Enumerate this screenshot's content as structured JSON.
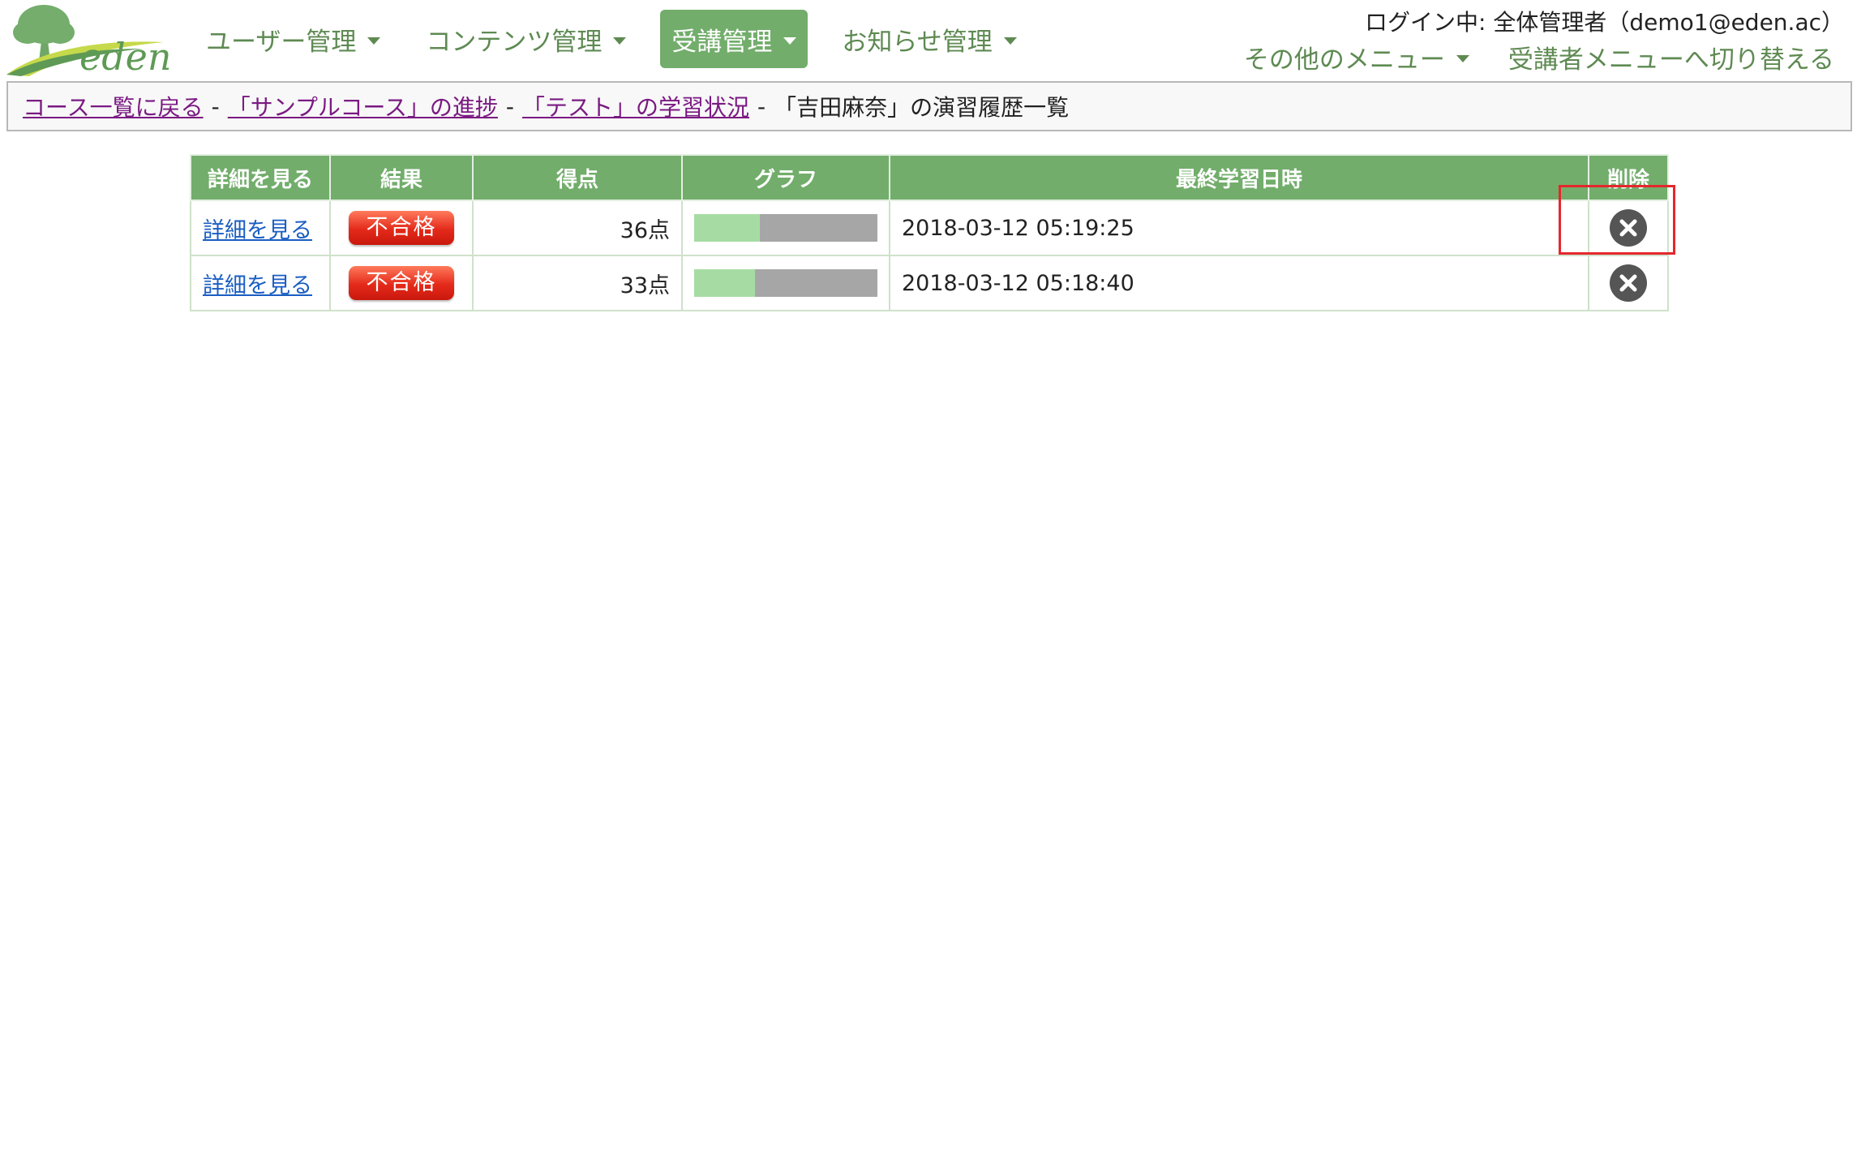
{
  "header": {
    "logo_text": "eden",
    "nav": [
      {
        "label": "ユーザー管理",
        "active": false
      },
      {
        "label": "コンテンツ管理",
        "active": false
      },
      {
        "label": "受講管理",
        "active": true
      },
      {
        "label": "お知らせ管理",
        "active": false
      }
    ],
    "login_info": "ログイン中: 全体管理者（demo1@eden.ac）",
    "other_menu": "その他のメニュー",
    "switch_menu": "受講者メニューへ切り替える"
  },
  "breadcrumb": {
    "items": [
      "コース一覧に戻る",
      "「サンプルコース」の進捗",
      "「テスト」の学習状況"
    ],
    "separator": "-",
    "current": "「吉田麻奈」の演習履歴一覧"
  },
  "table": {
    "headers": [
      "詳細を見る",
      "結果",
      "得点",
      "グラフ",
      "最終学習日時",
      "削除"
    ],
    "rows": [
      {
        "detail": "詳細を見る",
        "result": "不合格",
        "score": "36点",
        "score_value": 36,
        "date": "2018-03-12 05:19:25"
      },
      {
        "detail": "詳細を見る",
        "result": "不合格",
        "score": "33点",
        "score_value": 33,
        "date": "2018-03-12 05:18:40"
      }
    ]
  },
  "colors": {
    "brand_green": "#72ad6b",
    "nav_text": "#5e8a52",
    "fail_red": "#e42a1a",
    "bar_fill": "#a6dca3",
    "bar_track": "#a6a6a6",
    "highlight": "#e5272d"
  }
}
